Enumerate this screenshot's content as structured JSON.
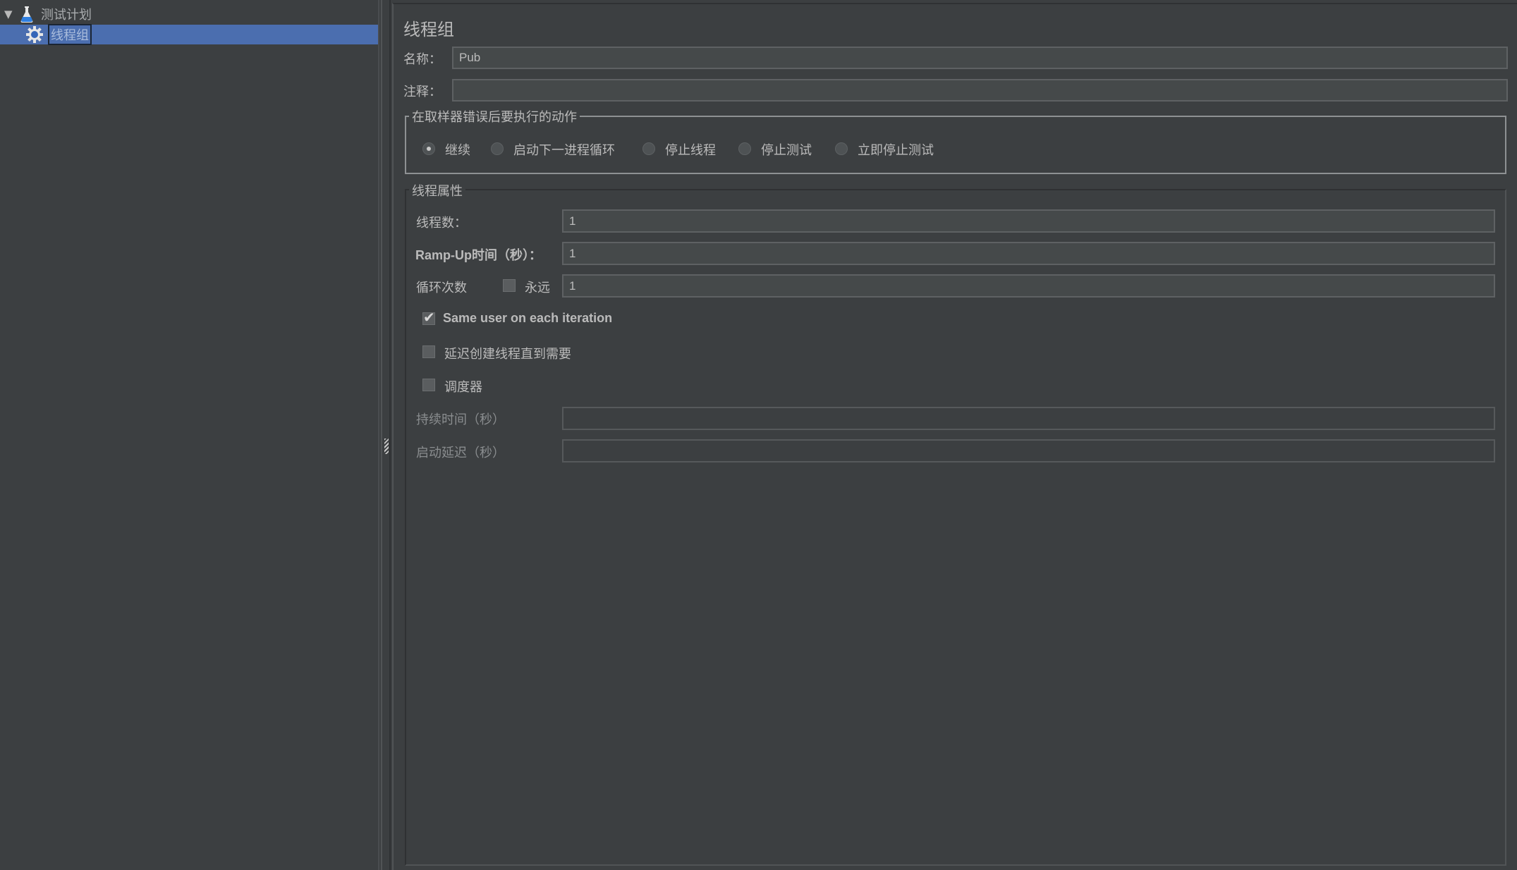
{
  "tree": {
    "items": [
      {
        "label": "测试计划",
        "icon": "flask-icon",
        "expanded": true,
        "selected": false
      },
      {
        "label": "线程组",
        "icon": "gear-icon",
        "selected": true
      }
    ]
  },
  "panel": {
    "title": "线程组",
    "name_label": "名称：",
    "name_value": "Pub",
    "comment_label": "注释：",
    "comment_value": "",
    "error_action": {
      "legend": "在取样器错误后要执行的动作",
      "options": [
        "继续",
        "启动下一进程循环",
        "停止线程",
        "停止测试",
        "立即停止测试"
      ],
      "selected": "继续"
    },
    "thread_props": {
      "legend": "线程属性",
      "threads_label": "线程数：",
      "threads_value": "1",
      "rampup_label": "Ramp-Up时间（秒）：",
      "rampup_value": "1",
      "loop_label": "循环次数",
      "forever_label": "永远",
      "forever_checked": false,
      "loop_value": "1",
      "same_user_label": "Same user on each iteration",
      "same_user_checked": true,
      "delay_create_label": "延迟创建线程直到需要",
      "delay_create_checked": false,
      "scheduler_label": "调度器",
      "scheduler_checked": false,
      "duration_label": "持续时间（秒）",
      "duration_value": "",
      "startup_delay_label": "启动延迟（秒）",
      "startup_delay_value": ""
    }
  }
}
